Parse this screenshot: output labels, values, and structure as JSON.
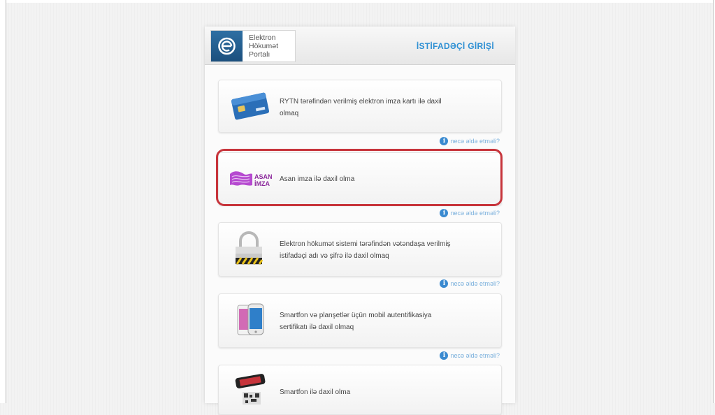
{
  "header": {
    "logo_lines": [
      "Elektron",
      "Hökumət",
      "Portalı"
    ],
    "title": "İSTİFADƏÇİ GİRİŞİ"
  },
  "options": [
    {
      "text": "RYTN tərəfindən verilmiş elektron imza kartı ilə daxil olmaq",
      "icon": "smart-card-icon"
    },
    {
      "text": "Asan imza ilə daxil olma",
      "icon": "asan-imza-icon",
      "highlighted": true
    },
    {
      "text": "Elektron hökumət sistemi tərəfindən vətəndaşa verilmiş istifadəçi adı və şifrə ilə daxil olmaq",
      "icon": "padlock-icon"
    },
    {
      "text": "Smartfon və planşetlər üçün mobil autentifikasiya sertifikatı ilə daxil olmaq",
      "icon": "smartphones-icon"
    },
    {
      "text": "Smartfon ilə daxil olma",
      "icon": "qr-phone-icon"
    }
  ],
  "help_link": "necə əldə etməli?",
  "colors": {
    "accent": "#2d8fd3",
    "highlight": "#c7343b",
    "asan_purple": "#8c2a9c"
  }
}
